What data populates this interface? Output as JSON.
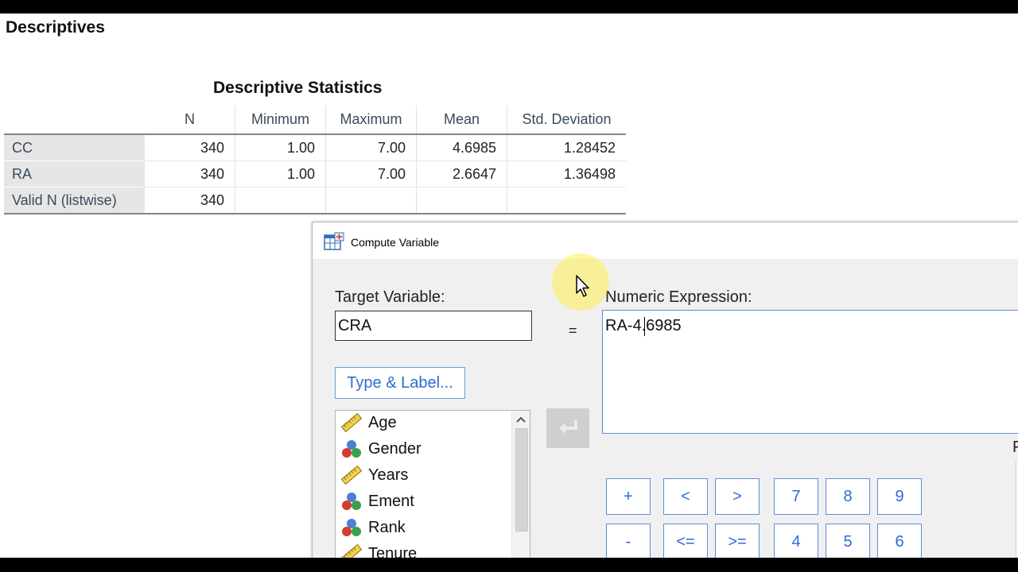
{
  "output": {
    "heading": "Descriptives",
    "table_title": "Descriptive Statistics",
    "columns": [
      "N",
      "Minimum",
      "Maximum",
      "Mean",
      "Std. Deviation"
    ],
    "rows": [
      {
        "label": "CC",
        "n": "340",
        "min": "1.00",
        "max": "7.00",
        "mean": "4.6985",
        "sd": "1.28452"
      },
      {
        "label": "RA",
        "n": "340",
        "min": "1.00",
        "max": "7.00",
        "mean": "2.6647",
        "sd": "1.36498"
      },
      {
        "label": "Valid N (listwise)",
        "n": "340",
        "min": "",
        "max": "",
        "mean": "",
        "sd": ""
      }
    ]
  },
  "dialog": {
    "title": "Compute Variable",
    "target_label": "Target Variable:",
    "target_value": "CRA",
    "equals": "=",
    "expression_label": "Numeric Expression:",
    "expression_value": "RA-4.6985",
    "type_label_button": "Type & Label...",
    "functions_label_partial": "F",
    "variables": [
      {
        "name": "Age",
        "icon": "scale-ruler-icon"
      },
      {
        "name": "Gender",
        "icon": "nominal-balls-icon"
      },
      {
        "name": "Years",
        "icon": "scale-ruler-icon"
      },
      {
        "name": "Ement",
        "icon": "nominal-balls-icon"
      },
      {
        "name": "Rank",
        "icon": "nominal-balls-icon"
      },
      {
        "name": "Tenure",
        "icon": "scale-ruler-icon"
      }
    ],
    "keypad_row1": [
      "+",
      "<",
      ">",
      "7",
      "8",
      "9"
    ],
    "keypad_row2": [
      "-",
      "<=",
      ">=",
      "4",
      "5",
      "6"
    ]
  },
  "colors": {
    "accent_blue": "#2f6bd2",
    "button_border": "#5b8fd8",
    "row_label_bg": "#e6e6e6",
    "cursor_highlight": "#fff050"
  }
}
